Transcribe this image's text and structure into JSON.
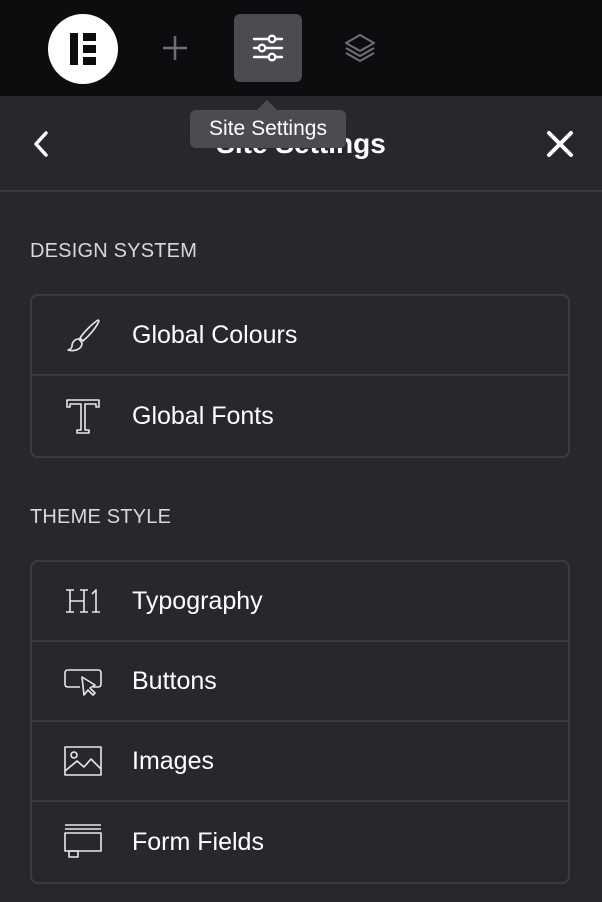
{
  "toolbar": {
    "logo_icon": "elementor-logo-icon",
    "add_icon": "plus-icon",
    "settings_icon": "sliders-icon",
    "layers_icon": "layers-icon"
  },
  "tooltip": {
    "text": "Site Settings"
  },
  "header": {
    "title": "Site Settings",
    "back_icon": "chevron-left-icon",
    "close_icon": "close-icon"
  },
  "sections": {
    "design_system": {
      "title": "DESIGN SYSTEM",
      "items": [
        {
          "label": "Global Colours",
          "icon": "paintbrush-icon"
        },
        {
          "label": "Global Fonts",
          "icon": "type-icon"
        }
      ]
    },
    "theme_style": {
      "title": "THEME STYLE",
      "items": [
        {
          "label": "Typography",
          "icon": "heading-h1-icon"
        },
        {
          "label": "Buttons",
          "icon": "button-cursor-icon"
        },
        {
          "label": "Images",
          "icon": "image-icon"
        },
        {
          "label": "Form Fields",
          "icon": "form-field-icon"
        }
      ]
    }
  },
  "colors": {
    "topbar_bg": "#0c0d0e",
    "panel_bg": "#27282c",
    "active_button_bg": "#4a4c52",
    "border": "#3a3c42"
  }
}
